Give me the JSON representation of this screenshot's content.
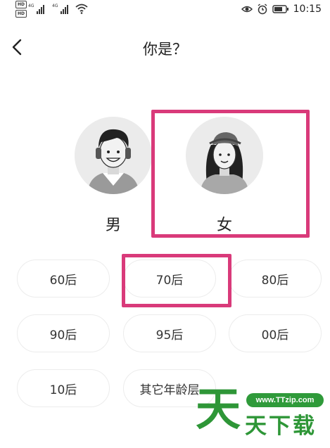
{
  "status_bar": {
    "hd_badge": "HD",
    "network": "4G",
    "time": "10:15"
  },
  "header": {
    "title": "你是？"
  },
  "gender": {
    "male_label": "男",
    "female_label": "女",
    "selected": "female"
  },
  "age_options": [
    "60后",
    "70后",
    "80后",
    "90后",
    "95后",
    "00后",
    "10后",
    "其它年龄层"
  ],
  "age_selected": "70后",
  "watermark": {
    "url": "www.TTzip.com",
    "big_char": "天",
    "text": "天下载"
  },
  "colors": {
    "highlight": "#d93a7a",
    "watermark_green": "#2e9637"
  },
  "icons": [
    "back-arrow-icon",
    "eye-icon",
    "alarm-icon",
    "battery-icon",
    "wifi-icon",
    "signal-icon"
  ]
}
